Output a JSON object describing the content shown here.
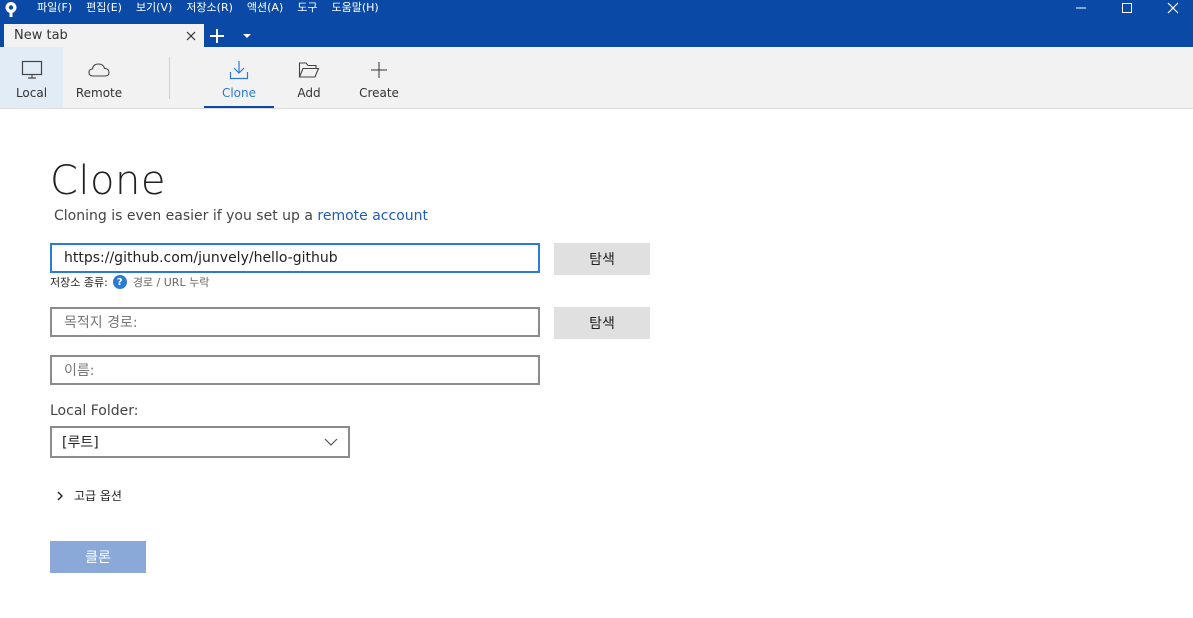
{
  "menu": {
    "items": [
      "파일(F)",
      "편집(E)",
      "보기(V)",
      "저장소(R)",
      "액션(A)",
      "도구",
      "도움말(H)"
    ]
  },
  "tabs": {
    "active_label": "New tab"
  },
  "toolbar": {
    "local_label": "Local",
    "remote_label": "Remote",
    "clone_label": "Clone",
    "add_label": "Add",
    "create_label": "Create",
    "active": "Clone"
  },
  "clone": {
    "title": "Clone",
    "subtitle_prefix": "Cloning is even easier if you set up a ",
    "subtitle_link": "remote account",
    "url_value": "https://github.com/junvely/hello-github",
    "browse_label": "탐색",
    "repo_type_label": "저장소 종류:",
    "repo_type_help": "?",
    "repo_type_value": "경로 / URL 누락",
    "dest_placeholder": "목적지 경로:",
    "name_placeholder": "이름:",
    "local_folder_label": "Local Folder:",
    "local_folder_value": "[루트]",
    "advanced_label": "고급 옵션",
    "clone_button": "클론"
  },
  "colors": {
    "titlebar": "#0a4aa6",
    "accent": "#2a7bd6",
    "link": "#1f5db8",
    "clone_button_disabled": "#8aa8d8"
  },
  "icons": {
    "app": "sourcetree-logo-icon",
    "local": "monitor-icon",
    "remote": "cloud-icon",
    "clone": "download-icon",
    "add": "folder-open-icon",
    "create": "plus-icon"
  }
}
